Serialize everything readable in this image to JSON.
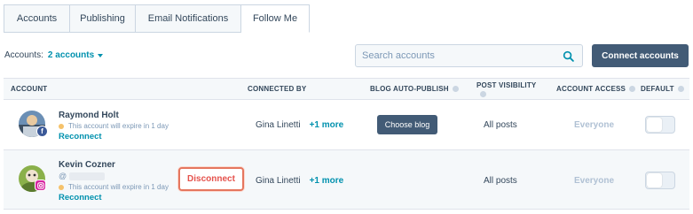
{
  "tabs": [
    {
      "label": "Accounts"
    },
    {
      "label": "Publishing"
    },
    {
      "label": "Email Notifications"
    },
    {
      "label": "Follow Me"
    }
  ],
  "active_tab": "Follow Me",
  "toolbar": {
    "accounts_label": "Accounts:",
    "accounts_dropdown": "2 accounts",
    "search_placeholder": "Search accounts",
    "connect_button": "Connect accounts"
  },
  "table": {
    "headers": {
      "account": "ACCOUNT",
      "connected_by": "CONNECTED BY",
      "blog_auto_publish": "BLOG AUTO-PUBLISH",
      "post_visibility": "POST VISIBILITY",
      "account_access": "ACCOUNT ACCESS",
      "default": "DEFAULT"
    },
    "rows": [
      {
        "name": "Raymond Holt",
        "network": "facebook",
        "network_badge": "f",
        "warning": "This account will expire in 1 day",
        "reconnect": "Reconnect",
        "connected_by": "Gina Linetti",
        "connected_more": "+1 more",
        "blog_action": "Choose blog",
        "post_visibility": "All posts",
        "account_access": "Everyone",
        "default_enabled": false
      },
      {
        "name": "Kevin Cozner",
        "network": "instagram",
        "handle_prefix": "@",
        "warning": "This account will expire in 1 day",
        "reconnect": "Reconnect",
        "disconnect": "Disconnect",
        "connected_by": "Gina Linetti",
        "connected_more": "+1 more",
        "post_visibility": "All posts",
        "account_access": "Everyone",
        "default_enabled": false
      }
    ]
  },
  "colors": {
    "link": "#0091ae",
    "primary_button": "#425b76",
    "warning_dot": "#f5c26b",
    "disconnect": "#e5524c",
    "facebook": "#3b5998",
    "instagram": "#d6249f"
  }
}
